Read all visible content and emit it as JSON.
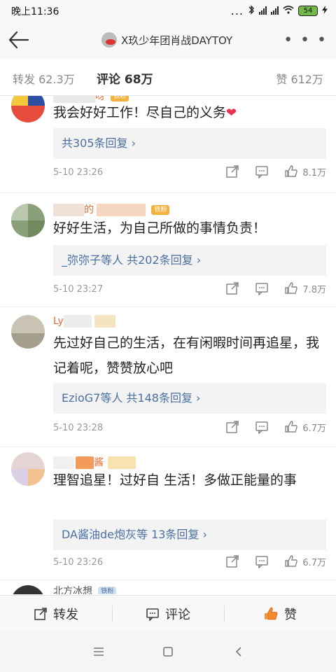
{
  "status_bar": {
    "time": "晚上11:36",
    "dots": "...",
    "battery": "54"
  },
  "header": {
    "title": "X玖少年团肖战DAYTOY"
  },
  "stats": {
    "repost": "转发 62.3万",
    "comment": "评论 68万",
    "like": "赞 612万"
  },
  "comments": [
    {
      "username_visible": "呀",
      "badge": "铁粉",
      "text": "我会好好工作！尽自己的义务",
      "emoji": "❤",
      "replies": "共305条回复 ›",
      "time": "5-10 23:26",
      "likes": "8.1万"
    },
    {
      "username_visible": "的",
      "badge": "铁粉",
      "text": "好好生活，为自己所做的事情负责！",
      "replies": "_弥弥子等人  共202条回复 ›",
      "time": "5-10 23:27",
      "likes": "7.8万"
    },
    {
      "username_visible": "Ly",
      "badge": "",
      "text": "先过好自己的生活，在有闲暇时间再追星，我记着呢，赞赞放心吧",
      "replies": "EzioG7等人  共148条回复 ›",
      "time": "5-10 23:28",
      "likes": "6.7万"
    },
    {
      "username_visible": "酱",
      "badge": "",
      "text": "理智追星！过好自 生活！多做正能量的事",
      "replies": "DA酱油de炮灰等  13条回复 ›",
      "time": "5-10 23:26",
      "likes": "6.7万"
    },
    {
      "username_visible": "北方冰想",
      "badge": "铁粉"
    }
  ],
  "toolbar": {
    "repost": "转发",
    "comment": "评论",
    "like": "赞"
  },
  "colors": {
    "accent": "#ff8200",
    "link": "#4a6fa1",
    "username": "#e86a2f",
    "badge": "#f5b13d"
  }
}
